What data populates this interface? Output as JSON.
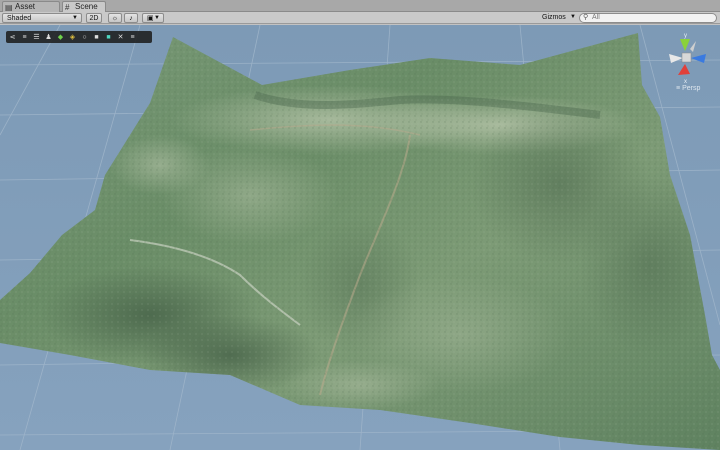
{
  "tabs": [
    {
      "label": "Asset Store",
      "icon": "store-icon",
      "active": false
    },
    {
      "label": "Scene",
      "icon": "grid-icon",
      "active": true
    }
  ],
  "toolbar": {
    "draw_mode": "Shaded",
    "mode_2d": "2D",
    "gizmos_label": "Gizmos",
    "search_value": "All"
  },
  "scene_tools": [
    "share-icon",
    "layers-icon",
    "list-icon",
    "person-icon",
    "diamond-icon",
    "tag-icon",
    "circle-icon",
    "camera-icon",
    "square-icon",
    "close-icon",
    "menu-icon"
  ],
  "orientation_gizmo": {
    "axis_labels": {
      "y": "y",
      "x": "x"
    },
    "projection_label": "Persp"
  },
  "colors": {
    "sky": "#7f9bb7",
    "grid": "#9fb6cc",
    "terrain_base": "#6c8e6a",
    "terrain_light": "#a4b7a0",
    "accent_x": "#e0403a",
    "accent_y": "#8ad23a",
    "accent_z": "#3a7ae0"
  }
}
